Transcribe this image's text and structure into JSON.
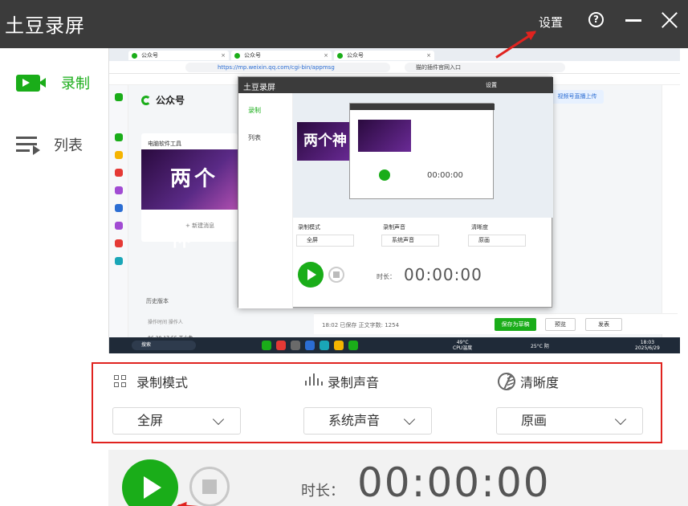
{
  "window": {
    "title": "土豆录屏",
    "settings_label": "设置",
    "help_icon": "help-icon",
    "minimize_icon": "minimize-icon",
    "close_icon": "close-icon"
  },
  "sidebar": {
    "items": [
      {
        "label": "录制",
        "icon": "video-record-icon",
        "active": true
      },
      {
        "label": "列表",
        "icon": "list-icon",
        "active": false
      }
    ]
  },
  "preview": {
    "browser_tabs": [
      "公众号",
      "公众号",
      "公众号"
    ],
    "url": "https://mp.weixin.qq.com/cgi-bin/appmsg",
    "search_placeholder": "猫的插件官网入口",
    "brand": "公众号",
    "card_title": "电脑软件工具",
    "card_image_text": "两个神",
    "new_label": "+ 新建消息",
    "publish_button": "视频号直播上传",
    "history_label": "历史版本",
    "history_headers": "操作时间      操作人",
    "history_row": "06-29 17:55      王小鱼",
    "autosave": "18:02 已保存   正文字数: 1254",
    "save_button": "保存为草稿",
    "preview_button": "预览",
    "post_button": "发表",
    "taskbar_search": "搜索",
    "taskbar_temp": "49°C\nCPU温度",
    "taskbar_weather": "25°C 阴",
    "taskbar_clock": "18:03\n2025/6/29",
    "nested": {
      "title": "土豆录屏",
      "settings": "设置",
      "nav_record": "录制",
      "nav_list": "列表",
      "mode_label": "录制模式",
      "audio_label": "录制声音",
      "quality_label": "清晰度",
      "mode_value": "全屏",
      "audio_value": "系统声音",
      "quality_value": "原画",
      "duration_label": "时长：",
      "timer": "00:00:00",
      "big_text": "两个神",
      "inner_timer": "00:00:00"
    }
  },
  "settings": {
    "mode": {
      "label": "录制模式",
      "value": "全屏",
      "icon": "grid-icon"
    },
    "audio": {
      "label": "录制声音",
      "value": "系统声音",
      "icon": "audio-wave-icon"
    },
    "quality": {
      "label": "清晰度",
      "value": "原画",
      "icon": "quality-icon"
    }
  },
  "controls": {
    "record_icon": "play-icon",
    "stop_icon": "stop-icon",
    "duration_label": "时长：",
    "timer": "00:00:00"
  },
  "colors": {
    "accent": "#1aad19",
    "titlebar": "#3b3b3b",
    "annotation": "#e0231f"
  }
}
